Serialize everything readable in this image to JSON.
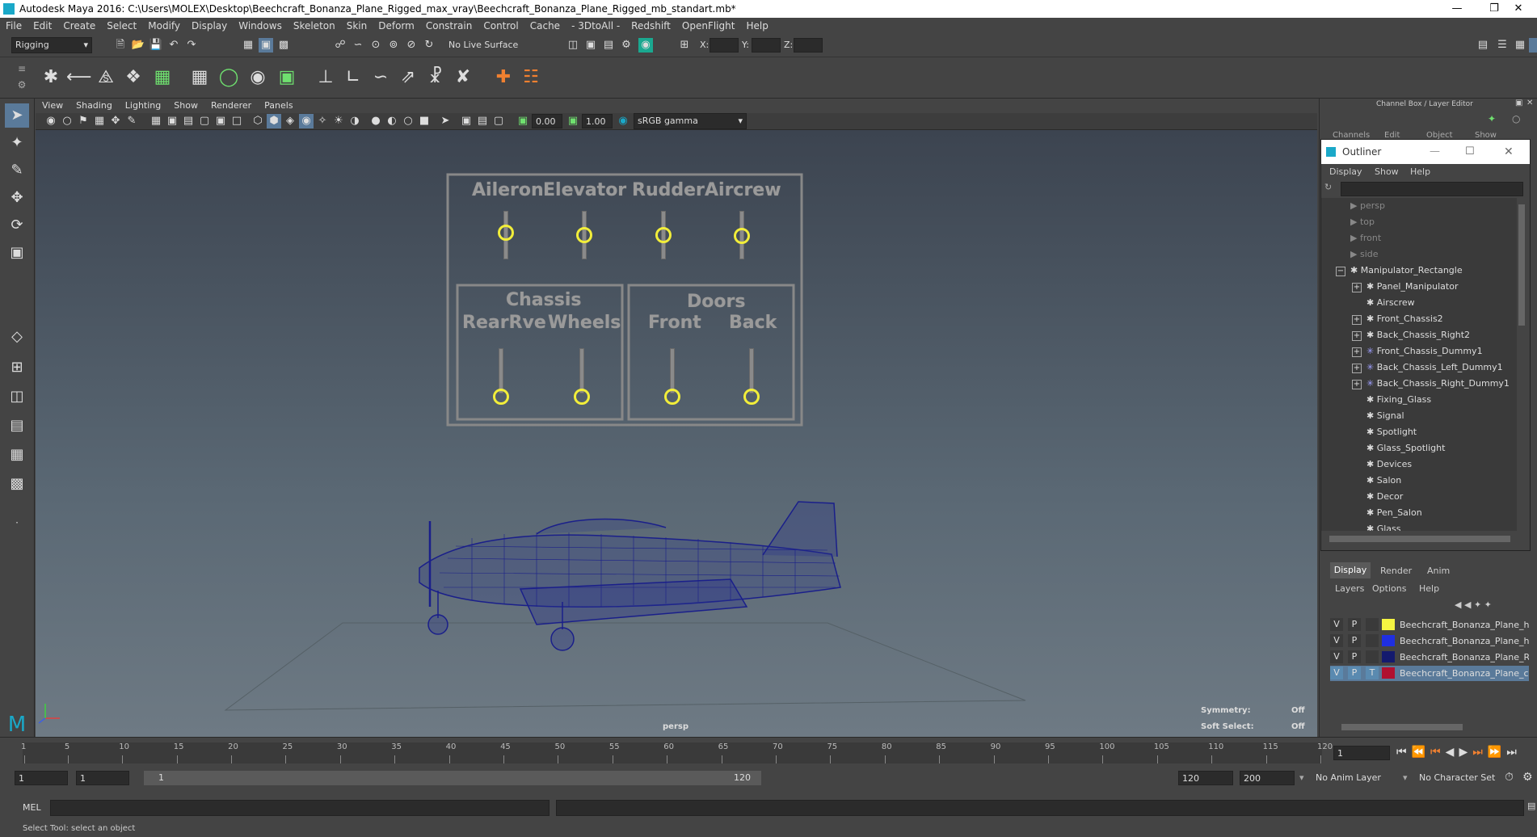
{
  "window": {
    "title": "Autodesk Maya 2016: C:\\Users\\MOLEX\\Desktop\\Beechcraft_Bonanza_Plane_Rigged_max_vray\\Beechcraft_Bonanza_Plane_Rigged_mb_standart.mb*"
  },
  "menubar": [
    "File",
    "Edit",
    "Create",
    "Select",
    "Modify",
    "Display",
    "Windows",
    "Skeleton",
    "Skin",
    "Deform",
    "Constrain",
    "Control",
    "Cache",
    "- 3DtoAll -",
    "Redshift",
    "OpenFlight",
    "Help"
  ],
  "status": {
    "mode": "Rigging",
    "live_surface": "No Live Surface",
    "x_label": "X:",
    "y_label": "Y:",
    "z_label": "Z:"
  },
  "panel_menu": [
    "View",
    "Shading",
    "Lighting",
    "Show",
    "Renderer",
    "Panels"
  ],
  "panel_toolbar": {
    "exposure": "0.00",
    "gamma": "1.00",
    "color_space": "sRGB gamma"
  },
  "viewport": {
    "camera": "persp",
    "symmetry_label": "Symmetry:",
    "symmetry_value": "Off",
    "soft_select_label": "Soft Select:",
    "soft_select_value": "Off",
    "controls_top": [
      "Aileron",
      "Elevator",
      "Rudder",
      "Aircrew"
    ],
    "chassis_title": "Chassis",
    "chassis_labels": [
      "RearRve",
      "Wheels"
    ],
    "doors_title": "Doors",
    "doors_labels": [
      "Front",
      "Back"
    ]
  },
  "channel_box": {
    "title": "Channel Box / Layer Editor",
    "tabs": [
      "Channels",
      "Edit",
      "Object",
      "Show"
    ]
  },
  "outliner": {
    "title": "Outliner",
    "menu": [
      "Display",
      "Show",
      "Help"
    ],
    "items": [
      "persp",
      "top",
      "front",
      "side",
      "Manipulator_Rectangle",
      "Panel_Manipulator",
      "Airscrew",
      "Front_Chassis2",
      "Back_Chassis_Right2",
      "Front_Chassis_Dummy1",
      "Back_Chassis_Left_Dummy1",
      "Back_Chassis_Right_Dummy1",
      "Fixing_Glass",
      "Signal",
      "Spotlight",
      "Glass_Spotlight",
      "Devices",
      "Salon",
      "Decor",
      "Pen_Salon",
      "Glass"
    ]
  },
  "layer_editor": {
    "tabs": [
      "Display",
      "Render",
      "Anim"
    ],
    "menu": [
      "Layers",
      "Options",
      "Help"
    ],
    "layers": [
      {
        "v": "V",
        "p": "P",
        "t": "",
        "name": "Beechcraft_Bonanza_Plane_he",
        "color": "#f5f542"
      },
      {
        "v": "V",
        "p": "P",
        "t": "",
        "name": "Beechcraft_Bonanza_Plane_he",
        "color": "#1f2fe0"
      },
      {
        "v": "V",
        "p": "P",
        "t": "",
        "name": "Beechcraft_Bonanza_Plane_Rig",
        "color": "#141a6e"
      },
      {
        "v": "V",
        "p": "P",
        "t": "T",
        "name": "Beechcraft_Bonanza_Plane_co",
        "color": "#b01030"
      }
    ]
  },
  "timeline": {
    "ticks": [
      "1",
      "5",
      "10",
      "15",
      "20",
      "25",
      "30",
      "35",
      "40",
      "45",
      "50",
      "55",
      "60",
      "65",
      "70",
      "75",
      "80",
      "85",
      "90",
      "95",
      "100",
      "105",
      "110",
      "115",
      "120"
    ],
    "current_frame": "1"
  },
  "range": {
    "start": "1",
    "start2": "1",
    "slider_start": "1",
    "slider_end": "120",
    "end": "120",
    "end2": "200",
    "anim_layer": "No Anim Layer",
    "character_set": "No Character Set"
  },
  "command": {
    "label": "MEL"
  },
  "help_line": "Select Tool: select an object"
}
